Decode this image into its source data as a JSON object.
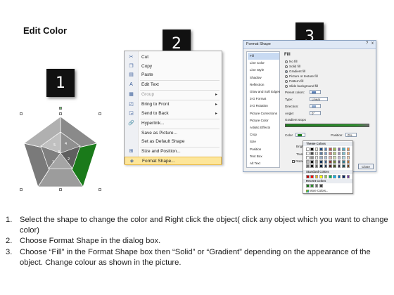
{
  "title": "Edit Color",
  "steps": [
    "1",
    "2",
    "3"
  ],
  "colors": {
    "accent_green": "#1a7a1a",
    "menu_highlight": "#fde69a",
    "dialog_blue": "#dfe8f5",
    "badge": "#111111"
  },
  "shape": {
    "labels": [
      "5",
      "4",
      "3",
      "2",
      "1"
    ]
  },
  "context_menu": {
    "items": [
      {
        "label": "Cut",
        "icon": "scissors-icon",
        "glyph": "✂",
        "disabled": false,
        "submenu": false,
        "highlight": false
      },
      {
        "label": "Copy",
        "icon": "copy-icon",
        "glyph": "❐",
        "disabled": false,
        "submenu": false,
        "highlight": false
      },
      {
        "label": "Paste",
        "icon": "paste-icon",
        "glyph": "▤",
        "disabled": false,
        "submenu": false,
        "highlight": false
      },
      {
        "label": "Edit Text",
        "icon": "edit-text-icon",
        "glyph": "A",
        "disabled": false,
        "submenu": false,
        "highlight": false
      },
      {
        "label": "Group",
        "icon": "group-icon",
        "glyph": "▦",
        "disabled": true,
        "submenu": true,
        "highlight": false
      },
      {
        "label": "Bring to Front",
        "icon": "bring-front-icon",
        "glyph": "◰",
        "disabled": false,
        "submenu": true,
        "highlight": false
      },
      {
        "label": "Send to Back",
        "icon": "send-back-icon",
        "glyph": "◲",
        "disabled": false,
        "submenu": true,
        "highlight": false
      },
      {
        "label": "Hyperlink...",
        "icon": "hyperlink-icon",
        "glyph": "🔗",
        "disabled": false,
        "submenu": false,
        "highlight": false
      },
      {
        "label": "Save as Picture...",
        "icon": "",
        "glyph": "",
        "disabled": false,
        "submenu": false,
        "highlight": false
      },
      {
        "label": "Set as Default Shape",
        "icon": "",
        "glyph": "",
        "disabled": false,
        "submenu": false,
        "highlight": false
      },
      {
        "label": "Size and Position...",
        "icon": "size-icon",
        "glyph": "⊞",
        "disabled": false,
        "submenu": false,
        "highlight": false
      },
      {
        "label": "Format Shape...",
        "icon": "format-shape-icon",
        "glyph": "◈",
        "disabled": false,
        "submenu": false,
        "highlight": true
      }
    ]
  },
  "dialog": {
    "title": "Format Shape",
    "window_buttons": [
      "?",
      "x"
    ],
    "nav": [
      "Fill",
      "Line Color",
      "Line Style",
      "Shadow",
      "Reflection",
      "Glow and Soft Edges",
      "3-D Format",
      "3-D Rotation",
      "Picture Corrections",
      "Picture Color",
      "Artistic Effects",
      "Crop",
      "Size",
      "Position",
      "Text Box",
      "Alt Text"
    ],
    "active_nav": "Fill",
    "heading": "Fill",
    "fill_options": [
      {
        "label": "No fill",
        "selected": false
      },
      {
        "label": "Solid fill",
        "selected": false
      },
      {
        "label": "Gradient fill",
        "selected": true
      },
      {
        "label": "Picture or texture fill",
        "selected": false
      },
      {
        "label": "Pattern fill",
        "selected": false
      },
      {
        "label": "Slide background fill",
        "selected": false
      }
    ],
    "preset_colors_label": "Preset colors:",
    "type_label": "Type:",
    "type_value": "Linear",
    "direction_label": "Direction:",
    "angle_label": "Angle:",
    "angle_value": "0°",
    "gradient_stops_label": "Gradient stops",
    "color_label": "Color",
    "position_label": "Position:",
    "position_value": "0%",
    "brightness_label": "Brightness:",
    "transparency_label": "Transparency:",
    "rotate_label": "Rotate with shape",
    "close_label": "Close"
  },
  "palette": {
    "theme_label": "Theme Colors",
    "standard_label": "Standard Colors",
    "recent_label": "Recent Colors",
    "more_label": "More Colors...",
    "theme_top": [
      "#ffffff",
      "#000000",
      "#eeece1",
      "#1f497d",
      "#4f81bd",
      "#c0504d",
      "#9bbb59",
      "#8064a2",
      "#4bacc6",
      "#f79646"
    ],
    "standard": [
      "#c00000",
      "#ff0000",
      "#ffc000",
      "#ffff00",
      "#92d050",
      "#00b050",
      "#00b0f0",
      "#0070c0",
      "#002060",
      "#7030a0"
    ],
    "recent": [
      "#1a7a1a",
      "#2e8f2e",
      "#6a6a6a",
      "#404040"
    ]
  },
  "instructions": [
    {
      "num": "1.",
      "text": "Select the shape to change the color and Right click the object( click any object which you want to change color)"
    },
    {
      "num": "2.",
      "text": "Choose Format Shape in the dialog box."
    },
    {
      "num": "3.",
      "text": "Choose “Fill” in the Format Shape box then “Solid” or “Gradient” depending on the appearance of the object. Change colour as shown in the picture."
    }
  ]
}
